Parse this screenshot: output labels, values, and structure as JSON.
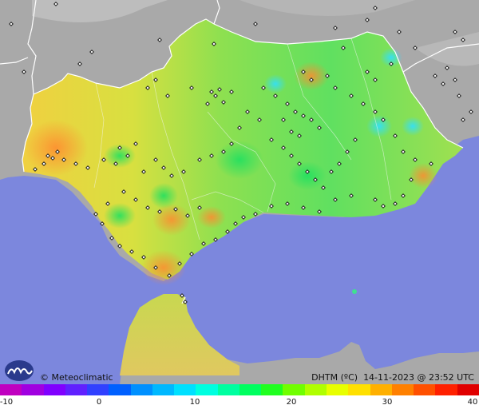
{
  "map": {
    "attribution": "Meteoclimatic",
    "variable": "DHTM (ºC)",
    "datetime": "14-11-2023 @ 23:52 UTC",
    "colors": {
      "sea": "#7c87dd",
      "land_outside": "#a8a8a8",
      "border": "#ffffff",
      "station_marker": "#111111"
    }
  },
  "scale": {
    "ticks": [
      "-10",
      "0",
      "10",
      "20",
      "30",
      "40"
    ],
    "colors": [
      "#c000c0",
      "#a000e0",
      "#8000ff",
      "#6020ff",
      "#3040ff",
      "#0060ff",
      "#0090ff",
      "#00b8ff",
      "#00e0ff",
      "#00ffe0",
      "#00ffa0",
      "#00ff60",
      "#20ff20",
      "#70ff00",
      "#b0ff00",
      "#e8ff00",
      "#ffe000",
      "#ffb000",
      "#ff8000",
      "#ff5000",
      "#ff2000",
      "#e00000"
    ]
  }
}
